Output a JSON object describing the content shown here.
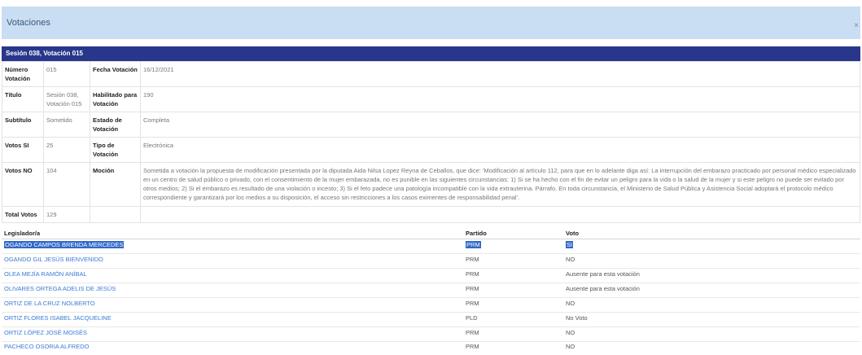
{
  "modal": {
    "title": "Votaciones",
    "close": "×"
  },
  "session_title": "Sesión 038, Votación 015",
  "info": {
    "numero_label": "Número Votación",
    "numero": "015",
    "fecha_label": "Fecha Votación",
    "fecha": "16/12/2021",
    "titulo_label": "Título",
    "titulo": "Sesión 038, Votación 015",
    "habilitado_label": "Habilitado para Votación",
    "habilitado": "190",
    "subtitulo_label": "Subtítulo",
    "subtitulo": "Sometido",
    "estado_label": "Estado de Votación",
    "estado": "Completa",
    "si_label": "Votos SI",
    "si": "25",
    "tipo_label": "Tipo de Votación",
    "tipo": "Electrónica",
    "no_label": "Votos NO",
    "no": "104",
    "mocion_label": "Moción",
    "mocion": "Sometida a votación la propuesta de modificación presentada por la diputada Aida Nilsa Lopez Reyna de Ceballos, que dice: 'Modificación al artículo 112, para que en lo adelante diga así: La interrupción del embarazo practicado por personal médico especializado en un centro de salud público o privado, con el consentimiento de la mujer embarazada, no es punible en las siguientes circunstancias: 1) Si se ha hecho con el fin de evitar un peligro para la vida o la salud de la mujer y si este peligro no puede ser evitado por otros medios; 2) Si el embarazo es resultado de una violación o incesto; 3) Si el feto padece una patología incompatible con la vida extrauterina. Párrafo. En toda circunstancia, el Ministerio de Salud Pública y Asistencia Social adoptará el protocolo médico correspondiente y garantizará por los medios a su disposición, el acceso sin restricciones a los casos eximentes de responsabilidad penal'.",
    "total_label": "Total Votos",
    "total": "129"
  },
  "votes_header": {
    "legislator": "Legislador/a",
    "party": "Partido",
    "vote": "Voto"
  },
  "votes": [
    {
      "name": "OGANDO CAMPOS BRENDA MERCEDES",
      "party": "PRM",
      "vote": "SI"
    },
    {
      "name": "OGANDO GIL JESÚS BIENVENIDO",
      "party": "PRM",
      "vote": "NO"
    },
    {
      "name": "OLEA MEJÍA RAMÓN ANÍBAL",
      "party": "PRM",
      "vote": "Ausente para esta votación"
    },
    {
      "name": "OLIVARES ORTEGA ADELIS DE JESÚS",
      "party": "PRM",
      "vote": "Ausente para esta votación"
    },
    {
      "name": "ORTIZ DE LA CRUZ NOLBERTO",
      "party": "PRM",
      "vote": "NO"
    },
    {
      "name": "ORTIZ FLORES ISABEL JACQUELINE",
      "party": "PLD",
      "vote": "No Voto"
    },
    {
      "name": "ORTIZ LÓPEZ JOSÉ MOISÉS",
      "party": "PRM",
      "vote": "NO"
    },
    {
      "name": "PACHECO OSORIA ALFREDO",
      "party": "PRM",
      "vote": "NO"
    }
  ]
}
